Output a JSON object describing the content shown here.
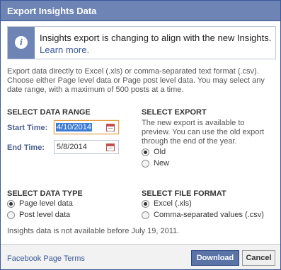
{
  "dialog": {
    "title": "Export Insights Data"
  },
  "notice": {
    "icon": "info-icon",
    "text": "Insights export is changing to align with the new Insights.",
    "link": "Learn more."
  },
  "intro": "Export data directly to Excel (.xls) or comma-separated text format (.csv). Choose either Page level data or Page post level data. You may select any date range, with a maximum of 500 posts at a time.",
  "date_range": {
    "heading": "SELECT DATA RANGE",
    "start_label": "Start Time:",
    "start_value": "4/10/2014",
    "end_label": "End Time:",
    "end_value": "5/8/2014"
  },
  "export_select": {
    "heading": "SELECT EXPORT",
    "note": "The new export is available to preview. You can use the old export through the end of the year.",
    "options": [
      {
        "label": "Old",
        "checked": true
      },
      {
        "label": "New",
        "checked": false
      }
    ]
  },
  "data_type": {
    "heading": "SELECT DATA TYPE",
    "options": [
      {
        "label": "Page level data",
        "checked": true
      },
      {
        "label": "Post level data",
        "checked": false
      }
    ]
  },
  "file_format": {
    "heading": "SELECT FILE FORMAT",
    "options": [
      {
        "label": "Excel (.xls)",
        "checked": true
      },
      {
        "label": "Comma-separated values (.csv)",
        "checked": false
      }
    ]
  },
  "availability_note": "Insights data is not available before July 19, 2011.",
  "footer": {
    "terms_link": "Facebook Page Terms",
    "download_label": "Download",
    "cancel_label": "Cancel"
  },
  "colors": {
    "header": "#6d84b4",
    "border": "#3b5998",
    "link": "#3b5998",
    "primary_button": "#5b74a8"
  }
}
